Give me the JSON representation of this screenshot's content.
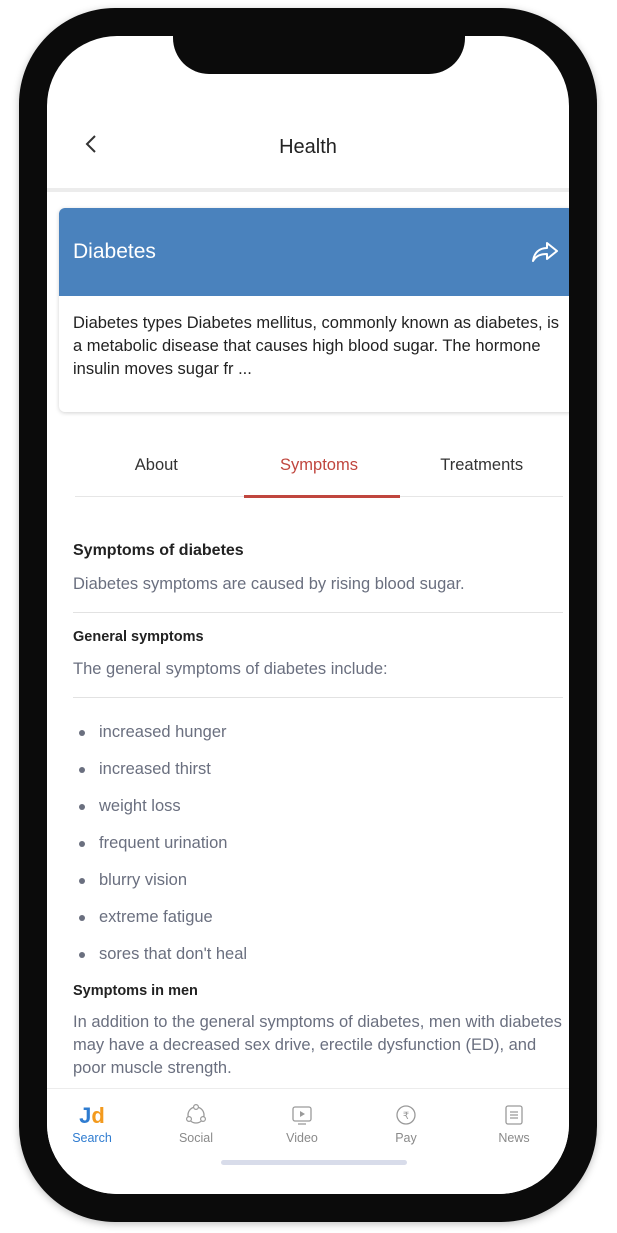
{
  "header": {
    "back_icon": "chevron-left-icon",
    "title": "Health"
  },
  "card": {
    "title": "Diabetes",
    "share_icon": "share-icon",
    "description": "Diabetes types Diabetes mellitus, commonly known as diabetes, is a metabolic disease that causes high blood sugar. The hormone insulin moves sugar fr ...",
    "header_color": "#4a82bd"
  },
  "tabs": [
    {
      "label": "About",
      "active": false
    },
    {
      "label": "Symptoms",
      "active": true
    },
    {
      "label": "Treatments",
      "active": false
    }
  ],
  "accent_color": "#c0463e",
  "content": {
    "heading": "Symptoms of diabetes",
    "intro": "Diabetes symptoms are caused by rising blood sugar.",
    "general_heading": "General symptoms",
    "general_intro": "The general symptoms of diabetes include:",
    "bullets": [
      "increased hunger",
      "increased thirst",
      "weight loss",
      "frequent urination",
      "blurry vision",
      "extreme fatigue",
      "sores that don't heal"
    ],
    "men_heading": "Symptoms in men",
    "men_text": "In addition to the general symptoms of diabetes, men with diabetes may have a decreased sex drive, erectile dysfunction (ED), and poor muscle strength."
  },
  "bottom_nav": [
    {
      "label": "Search",
      "icon": "jd-logo",
      "active": true
    },
    {
      "label": "Social",
      "icon": "social-icon",
      "active": false
    },
    {
      "label": "Video",
      "icon": "video-icon",
      "active": false
    },
    {
      "label": "Pay",
      "icon": "rupee-icon",
      "active": false
    },
    {
      "label": "News",
      "icon": "news-icon",
      "active": false
    }
  ],
  "brand": {
    "jd_j": "J",
    "jd_d": "d"
  }
}
